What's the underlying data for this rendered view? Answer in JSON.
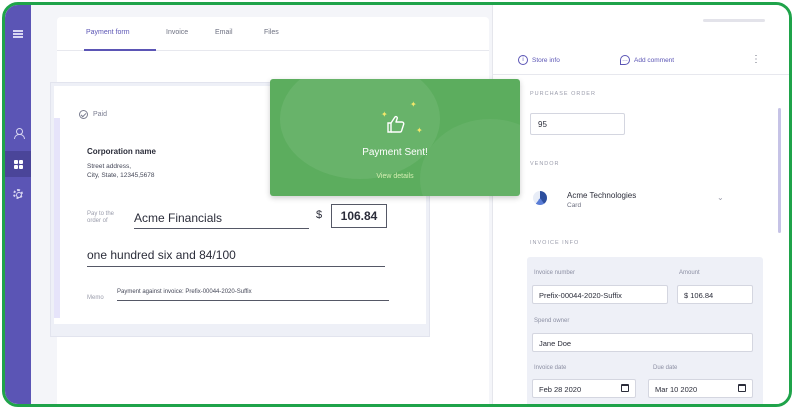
{
  "colors": {
    "frame": "#1fa34a",
    "rail": "#5b55b5",
    "accent": "#5b55b5",
    "toast": "#5cad5e"
  },
  "rail": {
    "icons": [
      "menu-icon",
      "user-icon",
      "grid-icon",
      "gear-icon"
    ]
  },
  "tabs": [
    {
      "label": "Payment form",
      "active": true
    },
    {
      "label": "Invoice",
      "active": false
    },
    {
      "label": "Email",
      "active": false
    },
    {
      "label": "Files",
      "active": false
    }
  ],
  "check": {
    "status": "Paid",
    "corp_name": "Corporation name",
    "address_line1": "Street address,",
    "address_line2": "City, State, 12345,5678",
    "pay_to_label": "Pay to the order of",
    "payee": "Acme Financials",
    "currency": "$",
    "amount": "106.84",
    "amount_words": "one hundred six and 84/100",
    "memo_label": "Memo",
    "memo": "Payment against invoice: Prefix-00044-2020-Suffix"
  },
  "toast": {
    "title": "Payment Sent!",
    "link": "View details"
  },
  "panel": {
    "actions": {
      "store_info": "Store info",
      "add_comment": "Add comment"
    },
    "purchase_order_label": "PURCHASE ORDER",
    "purchase_order_value": "95",
    "vendor_label": "VENDOR",
    "vendor_name": "Acme Technologies",
    "vendor_sub": "Card",
    "invoice_info_label": "INVOICE INFO",
    "invoice_number_label": "Invoice number",
    "invoice_number": "Prefix-00044-2020-Suffix",
    "amount_label": "Amount",
    "amount": "$ 106.84",
    "spend_owner_label": "Spend owner",
    "spend_owner": "Jane Doe",
    "invoice_date_label": "Invoice date",
    "invoice_date": "Feb 28 2020",
    "due_date_label": "Due date",
    "due_date": "Mar 10 2020"
  }
}
